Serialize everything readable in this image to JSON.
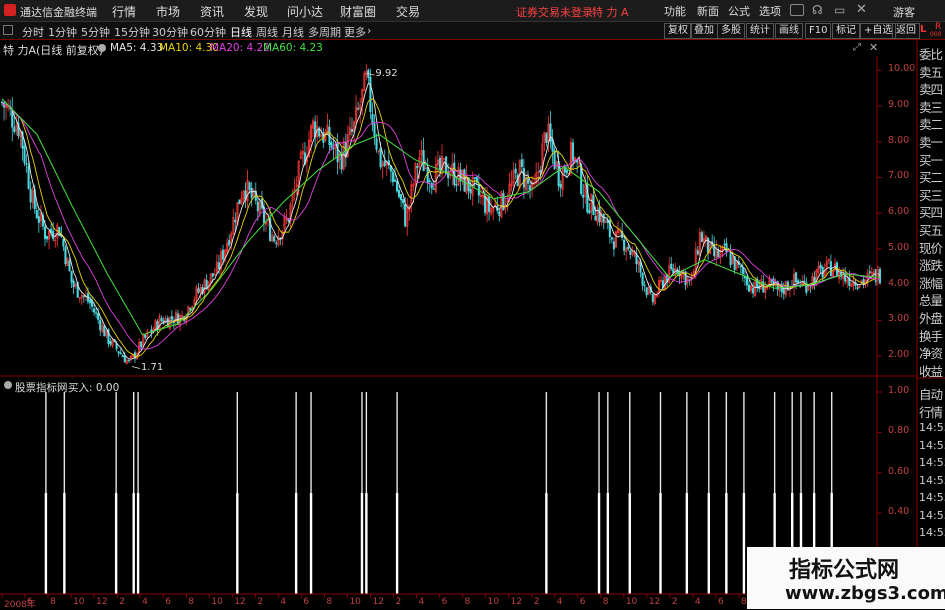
{
  "app": {
    "title": "通达信金融终端",
    "menus": [
      "行情",
      "市场",
      "资讯",
      "发现",
      "问小达",
      "财富圈",
      "交易"
    ],
    "notice": "证券交易未登录",
    "stock_title": "特 力 A",
    "right_menus": [
      "功能",
      "新面",
      "公式",
      "选项"
    ],
    "guest": "游客"
  },
  "toolbar": {
    "periods": [
      "分时",
      "1分钟",
      "5分钟",
      "15分钟",
      "30分钟",
      "60分钟",
      "日线",
      "周线",
      "月线",
      "多周期",
      "更多"
    ],
    "active": "日线",
    "right_buttons": [
      "复权",
      "叠加",
      "多股",
      "统计",
      "画线",
      "F10",
      "标记",
      "+自选",
      "返回"
    ],
    "more_arrow": "›"
  },
  "info": {
    "stock": "特 力A",
    "mode": "(日线 前复权)",
    "ma": [
      {
        "label": "MA5: 4.33",
        "color": "#e8e8e8"
      },
      {
        "label": "MA10: 4.30",
        "color": "#e8d200"
      },
      {
        "label": "MA20: 4.22",
        "color": "#e040e0"
      },
      {
        "label": "MA60: 4.23",
        "color": "#40e040"
      }
    ]
  },
  "indicator": {
    "name": "股票指标网",
    "value": "买入: 0.00"
  },
  "right_panel": {
    "top_label": "L",
    "top_label2": "R",
    "top_small": "000",
    "items": [
      "委比",
      "卖五",
      "卖四",
      "卖三",
      "卖二",
      "卖一",
      "买一",
      "买二",
      "买三",
      "买四",
      "买五",
      "现价",
      "涨跌",
      "涨幅",
      "总量",
      "外盘",
      "换手",
      "净资",
      "收益"
    ],
    "lower_items": [
      "自动",
      "行情"
    ],
    "times": [
      "14:55",
      "14:55",
      "14:55",
      "14:55",
      "14:55",
      "14:55",
      "14:55"
    ]
  },
  "watermark": {
    "title": "指标公式网",
    "url": "www.zbgs3.com"
  },
  "chart_data": [
    {
      "type": "line",
      "title": "特 力A (日线 前复权)",
      "y_ticks": [
        "10.00",
        "9.00",
        "8.00",
        "7.00",
        "6.00",
        "5.00",
        "4.00",
        "3.00",
        "2.00"
      ],
      "ylim": [
        1.5,
        10.4
      ],
      "annotations": [
        {
          "text": "9.92",
          "value": 9.92
        },
        {
          "text": "1.71",
          "value": 1.71
        }
      ],
      "x_ticks": [
        "2008年",
        "6",
        "8",
        "10",
        "12",
        "2",
        "4",
        "6",
        "8",
        "10",
        "12",
        "2",
        "4",
        "6",
        "8",
        "10",
        "12",
        "2",
        "4",
        "6",
        "8",
        "10",
        "12",
        "2",
        "4",
        "6",
        "8",
        "10",
        "12",
        "2",
        "4",
        "6",
        "8",
        "10"
      ],
      "series": [
        {
          "name": "MA5",
          "color": "#e8e8e8"
        },
        {
          "name": "MA10",
          "color": "#e8d200"
        },
        {
          "name": "MA20",
          "color": "#e040e0"
        },
        {
          "name": "MA60",
          "color": "#40e040"
        }
      ],
      "close_path": [
        [
          0,
          9.1
        ],
        [
          0.02,
          8.4
        ],
        [
          0.035,
          6.3
        ],
        [
          0.05,
          5.4
        ],
        [
          0.065,
          5.6
        ],
        [
          0.08,
          4.0
        ],
        [
          0.1,
          3.5
        ],
        [
          0.12,
          2.5
        ],
        [
          0.145,
          1.8
        ],
        [
          0.16,
          2.4
        ],
        [
          0.18,
          3.0
        ],
        [
          0.205,
          3.1
        ],
        [
          0.22,
          3.7
        ],
        [
          0.245,
          4.4
        ],
        [
          0.26,
          5.5
        ],
        [
          0.275,
          6.8
        ],
        [
          0.29,
          6.2
        ],
        [
          0.31,
          5.3
        ],
        [
          0.325,
          5.8
        ],
        [
          0.34,
          7.3
        ],
        [
          0.355,
          8.5
        ],
        [
          0.37,
          8.1
        ],
        [
          0.385,
          7.5
        ],
        [
          0.4,
          8.3
        ],
        [
          0.415,
          9.7
        ],
        [
          0.43,
          7.5
        ],
        [
          0.445,
          7.1
        ],
        [
          0.46,
          5.8
        ],
        [
          0.475,
          7.6
        ],
        [
          0.49,
          7.0
        ],
        [
          0.505,
          7.3
        ],
        [
          0.52,
          7.0
        ],
        [
          0.54,
          6.6
        ],
        [
          0.555,
          6.1
        ],
        [
          0.57,
          6.3
        ],
        [
          0.59,
          7.2
        ],
        [
          0.605,
          6.5
        ],
        [
          0.62,
          8.3
        ],
        [
          0.635,
          7.0
        ],
        [
          0.65,
          7.7
        ],
        [
          0.665,
          6.4
        ],
        [
          0.68,
          6.0
        ],
        [
          0.695,
          5.3
        ],
        [
          0.71,
          5.2
        ],
        [
          0.725,
          4.5
        ],
        [
          0.74,
          3.5
        ],
        [
          0.755,
          4.2
        ],
        [
          0.77,
          4.5
        ],
        [
          0.785,
          4.0
        ],
        [
          0.795,
          5.4
        ],
        [
          0.81,
          4.8
        ],
        [
          0.825,
          4.9
        ],
        [
          0.84,
          4.4
        ],
        [
          0.855,
          3.9
        ],
        [
          0.87,
          4.0
        ],
        [
          0.885,
          3.8
        ],
        [
          0.9,
          4.1
        ],
        [
          0.915,
          4.0
        ],
        [
          0.93,
          4.3
        ],
        [
          0.945,
          4.5
        ],
        [
          0.96,
          4.2
        ],
        [
          0.98,
          4.1
        ],
        [
          1.0,
          4.3
        ]
      ],
      "ma60_path": [
        [
          0,
          9.2
        ],
        [
          0.04,
          8.2
        ],
        [
          0.08,
          6.2
        ],
        [
          0.12,
          4.3
        ],
        [
          0.16,
          2.6
        ],
        [
          0.2,
          2.9
        ],
        [
          0.24,
          3.9
        ],
        [
          0.28,
          5.2
        ],
        [
          0.32,
          6.3
        ],
        [
          0.36,
          7.2
        ],
        [
          0.4,
          7.9
        ],
        [
          0.43,
          8.2
        ],
        [
          0.47,
          7.5
        ],
        [
          0.51,
          7.1
        ],
        [
          0.56,
          6.4
        ],
        [
          0.6,
          6.6
        ],
        [
          0.64,
          7.3
        ],
        [
          0.68,
          6.6
        ],
        [
          0.72,
          5.4
        ],
        [
          0.76,
          4.2
        ],
        [
          0.8,
          4.7
        ],
        [
          0.84,
          4.3
        ],
        [
          0.88,
          3.9
        ],
        [
          0.92,
          4.0
        ],
        [
          0.96,
          4.3
        ],
        [
          1.0,
          4.2
        ]
      ]
    },
    {
      "type": "bar",
      "title": "股票指标网 买入: 0.00",
      "y_ticks": [
        "1.00",
        "0.80",
        "0.60",
        "0.40",
        "0.20"
      ],
      "ylim": [
        0,
        1
      ],
      "values": [
        {
          "x": 0.05,
          "value": 1.0
        },
        {
          "x": 0.071,
          "value": 1.0
        },
        {
          "x": 0.13,
          "value": 1.0
        },
        {
          "x": 0.15,
          "value": 1.0
        },
        {
          "x": 0.155,
          "value": 1.0
        },
        {
          "x": 0.268,
          "value": 1.0
        },
        {
          "x": 0.335,
          "value": 1.0
        },
        {
          "x": 0.352,
          "value": 1.0
        },
        {
          "x": 0.41,
          "value": 1.0
        },
        {
          "x": 0.415,
          "value": 1.0
        },
        {
          "x": 0.45,
          "value": 1.0
        },
        {
          "x": 0.62,
          "value": 1.0
        },
        {
          "x": 0.68,
          "value": 1.0
        },
        {
          "x": 0.69,
          "value": 1.0
        },
        {
          "x": 0.715,
          "value": 1.0
        },
        {
          "x": 0.75,
          "value": 1.0
        },
        {
          "x": 0.78,
          "value": 1.0
        },
        {
          "x": 0.805,
          "value": 1.0
        },
        {
          "x": 0.825,
          "value": 1.0
        },
        {
          "x": 0.845,
          "value": 1.0
        },
        {
          "x": 0.88,
          "value": 1.0
        },
        {
          "x": 0.9,
          "value": 1.0
        },
        {
          "x": 0.91,
          "value": 1.0
        },
        {
          "x": 0.925,
          "value": 1.0
        },
        {
          "x": 0.945,
          "value": 1.0
        }
      ]
    }
  ]
}
